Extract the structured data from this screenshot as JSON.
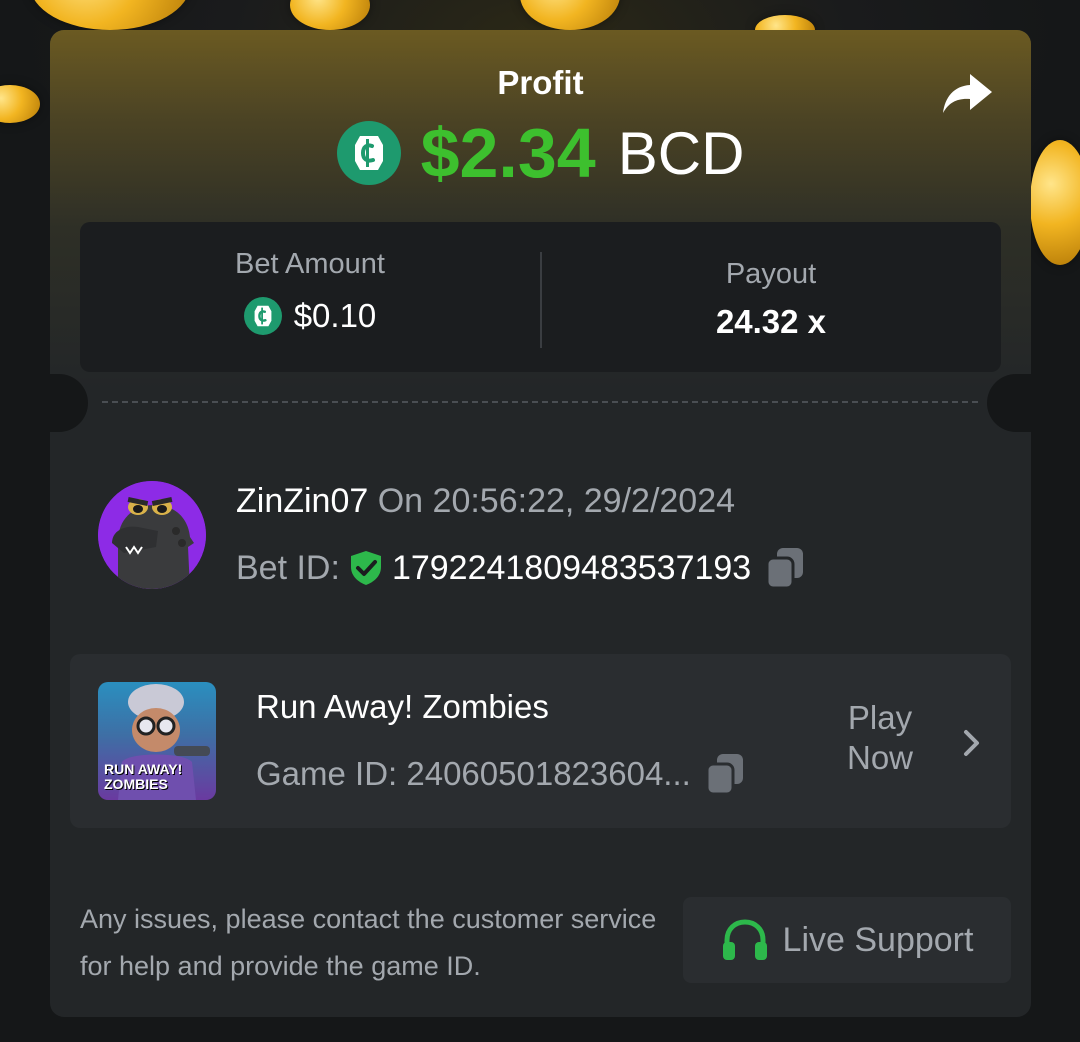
{
  "result": {
    "profit_label": "Profit",
    "profit_amount": "$2.34",
    "profit_currency": "BCD"
  },
  "stats": {
    "bet_amount_label": "Bet Amount",
    "bet_amount_value": "$0.10",
    "payout_label": "Payout",
    "payout_value": "24.32 x"
  },
  "user": {
    "name": "ZinZin07",
    "timestamp": "On 20:56:22, 29/2/2024",
    "bet_id_label": "Bet ID:",
    "bet_id": "1792241809483537193"
  },
  "game": {
    "title": "Run Away! Zombies",
    "game_id": "Game ID: 24060501823604...",
    "thumb_text_1": "RUN AWAY!",
    "thumb_text_2": "ZOMBIES",
    "play_label_1": "Play",
    "play_label_2": "Now"
  },
  "footer": {
    "help_text": "Any issues, please contact the customer service for help and provide the game ID.",
    "support_label": "Live Support"
  },
  "colors": {
    "profit_green": "#3dc02e",
    "bcd_green": "#1e9a6e",
    "verified_green": "#2db84b",
    "support_icon_green": "#2db84b",
    "card_bg": "#232628"
  },
  "icons": [
    "share-icon",
    "bcd-coin-icon",
    "verified-shield-icon",
    "copy-icon",
    "chevron-right-icon",
    "headset-icon"
  ]
}
